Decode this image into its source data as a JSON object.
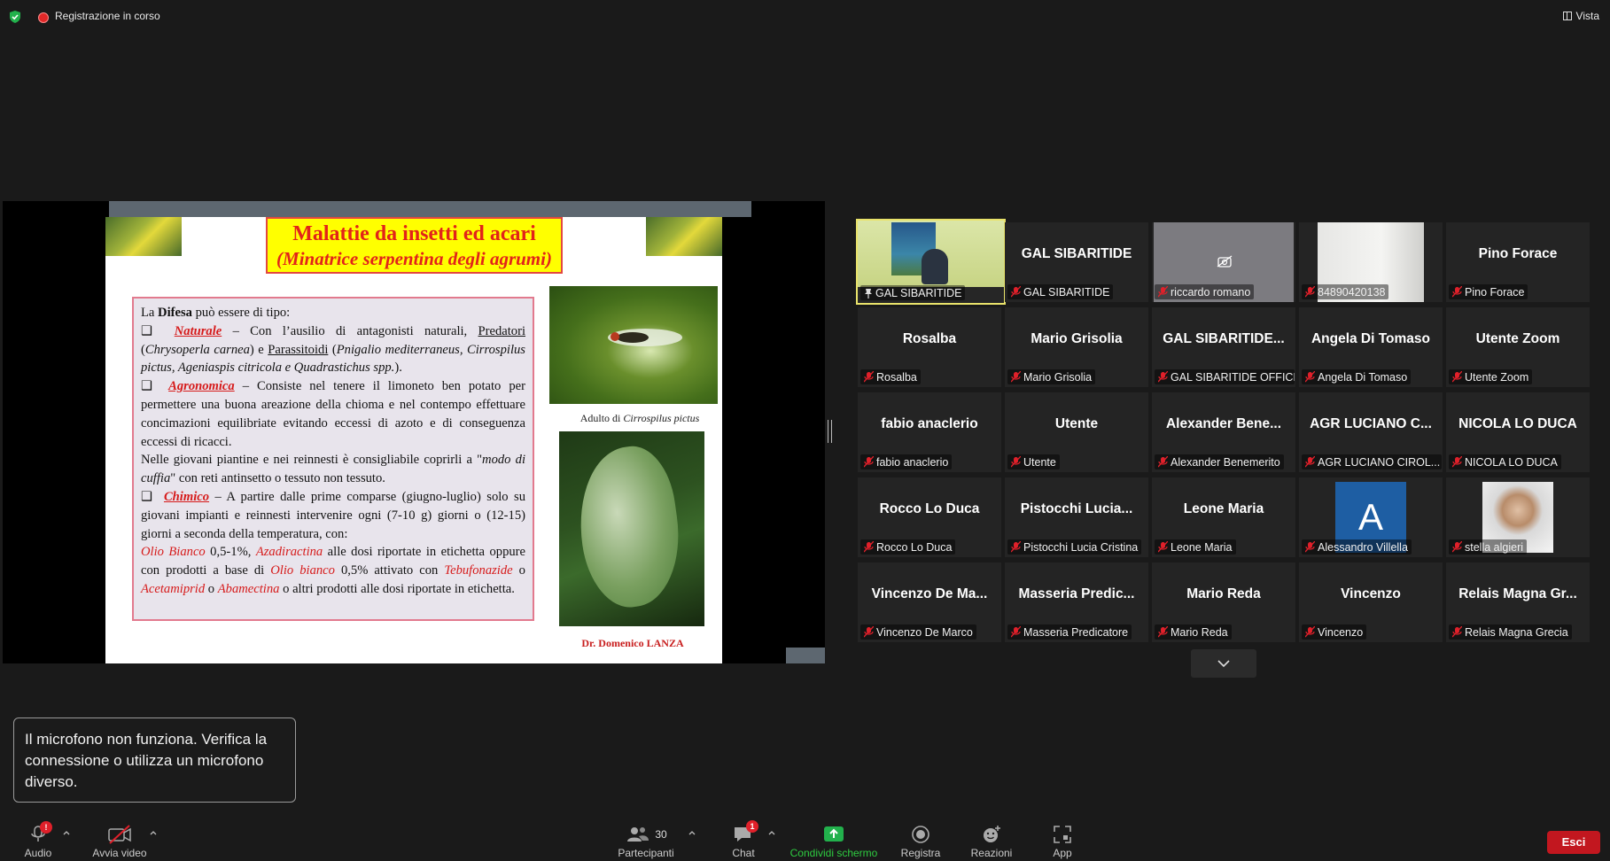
{
  "top_bar": {
    "recording_text": "Registrazione in corso",
    "view_label": "Vista"
  },
  "slide": {
    "title_line1": "Malattie da insetti ed acari",
    "title_line2": "(Minatrice serpentina degli agrumi)",
    "intro_prefix": "La ",
    "intro_bold": "Difesa",
    "intro_suffix": " può essere di tipo:",
    "bullet_checkbox": "❑",
    "naturale_label": "Naturale",
    "naturale_text_a": " – Con l’ausilio di antagonisti naturali, ",
    "naturale_predatori": "Predatori",
    "naturale_text_b": " (",
    "naturale_species1": "Chrysoperla carnea",
    "naturale_text_c": ") e ",
    "naturale_parassitoidi": "Parassitoidi",
    "naturale_text_d": " (",
    "naturale_species2": "Pnigalio mediterraneus, Cirrospilus pictus, Ageniaspis citricola e Quadrastichus spp.",
    "naturale_text_e": ").",
    "agronomica_label": "Agronomica",
    "agronomica_text": " – Consiste nel tenere il limoneto ben potato per permettere una buona areazione della chioma e nel contempo effettuare concimazioni equilibriate evitando eccessi di azoto e di conseguenza eccessi di ricacci.",
    "nursery_text_a": "Nelle giovani piantine e nei reinnesti è consigliabile coprirli a \"",
    "nursery_italic": "modo di cuffia",
    "nursery_text_b": "\" con reti antinsetto o tessuto non tessuto.",
    "chimico_label": "Chimico",
    "chimico_text": " – A partire dalle prime comparse (giugno-luglio) solo su giovani impianti e reinnesti intervenire ogni (7-10 g) giorni o (12-15) giorni a seconda della temperatura, con:",
    "product1": "Olio Bianco",
    "product1_text": " 0,5-1%, ",
    "product2": "Azadiractina",
    "product2_text": " alle dosi riportate in etichetta oppure con prodotti a base di ",
    "product3": "Olio bianco",
    "product3_text": " 0,5% attivato con ",
    "product4": "Tebufonazide",
    "product4_text": " o ",
    "product5": "Acetamiprid",
    "product5_text": " o ",
    "product6": "Abamectina",
    "product6_text": " o altri prodotti alle dosi riportate in etichetta.",
    "caption_prefix": "Adulto di ",
    "caption_italic": "Cirrospilus pictus",
    "author": "Dr. Domenico LANZA"
  },
  "participants": [
    {
      "display": "",
      "name": "GAL SIBARITIDE",
      "kind": "video",
      "active": true,
      "pinned": true
    },
    {
      "display": "GAL SIBARITIDE",
      "name": "GAL SIBARITIDE",
      "kind": "name"
    },
    {
      "display": "",
      "name": "riccardo romano",
      "kind": "camoff"
    },
    {
      "display": "",
      "name": "84890420138",
      "kind": "room"
    },
    {
      "display": "Pino Forace",
      "name": "Pino Forace",
      "kind": "name"
    },
    {
      "display": "Rosalba",
      "name": "Rosalba",
      "kind": "name"
    },
    {
      "display": "Mario Grisolia",
      "name": "Mario Grisolia",
      "kind": "name"
    },
    {
      "display": "GAL SIBARITIDE...",
      "name": "GAL SIBARITIDE OFFICE",
      "kind": "name"
    },
    {
      "display": "Angela Di Tomaso",
      "name": "Angela Di Tomaso",
      "kind": "name"
    },
    {
      "display": "Utente Zoom",
      "name": "Utente Zoom",
      "kind": "name"
    },
    {
      "display": "fabio anaclerio",
      "name": "fabio anaclerio",
      "kind": "name"
    },
    {
      "display": "Utente",
      "name": "Utente",
      "kind": "name"
    },
    {
      "display": "Alexander Bene...",
      "name": "Alexander Benemerito",
      "kind": "name"
    },
    {
      "display": "AGR LUCIANO C...",
      "name": "AGR LUCIANO CIROL...",
      "kind": "name"
    },
    {
      "display": "NICOLA LO DUCA",
      "name": "NICOLA LO DUCA",
      "kind": "name"
    },
    {
      "display": "Rocco Lo Duca",
      "name": "Rocco Lo Duca",
      "kind": "name"
    },
    {
      "display": "Pistocchi Lucia...",
      "name": "Pistocchi Lucia Cristina",
      "kind": "name"
    },
    {
      "display": "Leone Maria",
      "name": "Leone Maria",
      "kind": "name"
    },
    {
      "display": "A",
      "name": "Alessandro Villella",
      "kind": "avatar",
      "avatar_color": "#1e5ea3"
    },
    {
      "display": "",
      "name": "stella algieri",
      "kind": "photo"
    },
    {
      "display": "Vincenzo De Ma...",
      "name": "Vincenzo De Marco",
      "kind": "name"
    },
    {
      "display": "Masseria Predic...",
      "name": "Masseria Predicatore",
      "kind": "name"
    },
    {
      "display": "Mario Reda",
      "name": "Mario Reda",
      "kind": "name"
    },
    {
      "display": "Vincenzo",
      "name": "Vincenzo",
      "kind": "name"
    },
    {
      "display": "Relais Magna Gr...",
      "name": "Relais Magna Grecia",
      "kind": "name"
    }
  ],
  "toast": {
    "message": "Il microfono non funziona. Verifica la connessione o utilizza un microfono diverso."
  },
  "toolbar": {
    "audio_label": "Audio",
    "audio_badge": "!",
    "video_label": "Avvia video",
    "participants_label": "Partecipanti",
    "participants_count": "30",
    "chat_label": "Chat",
    "chat_badge": "1",
    "share_label": "Condividi schermo",
    "record_label": "Registra",
    "reactions_label": "Reazioni",
    "apps_label": "App",
    "exit_label": "Esci"
  },
  "colors": {
    "background": "#1a1a1a",
    "share_green": "#2ecc40",
    "exit_red": "#c2171f",
    "active_speaker_border": "#e9e36b",
    "muted_red": "#e0202a"
  }
}
